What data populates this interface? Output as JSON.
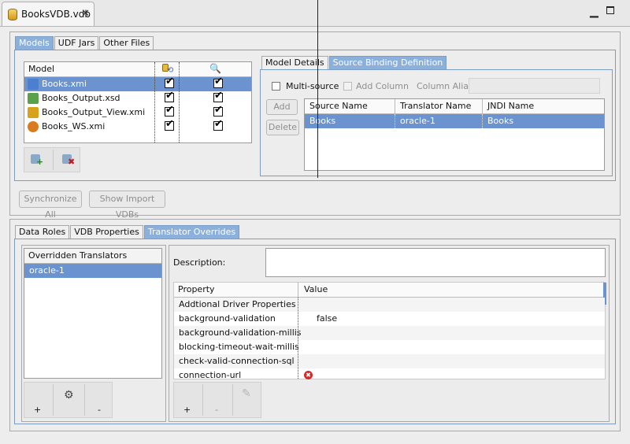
{
  "editor": {
    "tab_title": "BooksVDB.vdb"
  },
  "top_tabs": [
    "Models",
    "UDF Jars",
    "Other Files"
  ],
  "models_table": {
    "columns": [
      "Model"
    ],
    "rows": [
      {
        "name": "Books.xmi",
        "icon": "source-model-icon",
        "color": "#4b7fd0"
      },
      {
        "name": "Books_Output.xsd",
        "icon": "xsd-model-icon",
        "color": "#5aa24a"
      },
      {
        "name": "Books_Output_View.xmi",
        "icon": "view-model-icon",
        "color": "#d9a21c"
      },
      {
        "name": "Books_WS.xmi",
        "icon": "web-service-model-icon",
        "color": "#d97b1c"
      }
    ]
  },
  "model_details_tabs": [
    "Model Details",
    "Source Binding Definition"
  ],
  "source_binding": {
    "multi_source": "Multi-source",
    "add_column": "Add Column",
    "column_alias": "Column Alias",
    "add_button": "Add",
    "delete_button": "Delete",
    "columns": [
      "Source Name",
      "Translator Name",
      "JNDI Name"
    ],
    "rows": [
      {
        "source": "Books",
        "translator": "oracle-1",
        "jndi": "Books"
      }
    ]
  },
  "actions": {
    "synchronize_all": "Synchronize All",
    "show_import_vdbs": "Show Import VDBs"
  },
  "bottom_tabs": [
    "Data Roles",
    "VDB Properties",
    "Translator Overrides"
  ],
  "overrides": {
    "header": "Overridden Translators",
    "items": [
      "oracle-1"
    ],
    "add": "+",
    "remove": "-"
  },
  "properties": {
    "description_label": "Description:",
    "columns": [
      "Property",
      "Value"
    ],
    "rows": [
      {
        "property": "Addtional Driver Properties",
        "value": ""
      },
      {
        "property": "background-validation",
        "value": "false"
      },
      {
        "property": "background-validation-millis",
        "value": ""
      },
      {
        "property": "blocking-timeout-wait-millis",
        "value": ""
      },
      {
        "property": "check-valid-connection-sql",
        "value": ""
      },
      {
        "property": "connection-url",
        "value": ""
      }
    ],
    "add": "+",
    "remove": "-"
  },
  "colors": {
    "selection": "#6b93cf",
    "tab_selected": "#8cb0dc",
    "group_border": "#7d9cc2"
  }
}
